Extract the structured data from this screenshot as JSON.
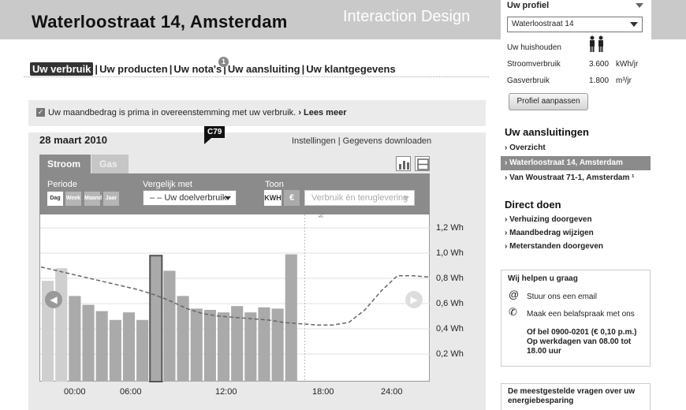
{
  "header": {
    "title": "Waterloostraat 14, Amsterdam",
    "watermark": "Interaction Design"
  },
  "nav": {
    "items": [
      "Uw verbruik",
      "Uw producten",
      "Uw nota's",
      "Uw aansluiting",
      "Uw klantgegevens"
    ],
    "separator": "|",
    "badge": "1"
  },
  "notice": {
    "text": "Uw maandbedrag is prima in overeenstemming met uw verbruik.",
    "link": "Lees meer",
    "link_prefix": "›"
  },
  "panel": {
    "date": "28 maart 2010",
    "marker": "C79",
    "links": {
      "settings": "Instellingen",
      "sep": "|",
      "download": "Gegevens downloaden"
    },
    "tabs": [
      "Stroom",
      "Gas"
    ],
    "periode_label": "Periode",
    "periode_buttons": [
      "Dag",
      "Week",
      "Maand",
      "Jaar"
    ],
    "vergelijk_label": "Vergelijk met",
    "vergelijk_value": "– – Uw doelverbruik",
    "toon_label": "Toon",
    "toon_buttons": [
      "KWH",
      "€"
    ],
    "toon_select": "Verbruik én teruglevering",
    "now_label": "Nu"
  },
  "chart_data": {
    "type": "bar",
    "unit": "Wh",
    "x_ticks": [
      "00:00",
      "06:00",
      "12:00",
      "18:00",
      "24:00"
    ],
    "y_ticks": [
      "0,2 Wh",
      "0,4 Wh",
      "0,6 Wh",
      "0,8 Wh",
      "1,0 Wh",
      "1,2 Wh"
    ],
    "ylim": [
      0.1,
      1.3
    ],
    "hours": [
      0,
      1,
      2,
      3,
      4,
      5,
      6,
      7,
      8,
      9,
      10,
      11,
      12,
      13,
      14,
      15,
      16,
      17,
      18
    ],
    "values": [
      0.78,
      0.88,
      0.66,
      0.59,
      0.54,
      0.47,
      0.53,
      0.47,
      0.98,
      0.86,
      0.66,
      0.56,
      0.55,
      0.53,
      0.58,
      0.53,
      0.57,
      0.56,
      0.99
    ],
    "target_line": [
      0.89,
      0.86,
      0.83,
      0.8,
      0.77,
      0.74,
      0.71,
      0.67,
      0.62,
      0.56,
      0.52,
      0.5,
      0.49,
      0.48,
      0.47,
      0.45,
      0.44,
      0.43,
      0.43,
      0.45,
      0.55,
      0.7,
      0.82,
      0.82,
      0.81
    ],
    "selected_hour": 8,
    "now_hour": 19.5,
    "colors": {
      "bar_past": "#cfcfcf",
      "bar_today": "#aaaaaa",
      "selected_border": "#555555",
      "target": "#666666"
    }
  },
  "profile": {
    "title": "Uw profiel",
    "address": "Waterloostraat 14",
    "rows": [
      {
        "label": "Uw huishouden",
        "value": "",
        "unit": ""
      },
      {
        "label": "Stroomverbruik",
        "value": "3.600",
        "unit": "kWh/jr"
      },
      {
        "label": "Gasverbruik",
        "value": "1.800",
        "unit": "m³/jr"
      }
    ],
    "button": "Profiel aanpassen"
  },
  "aansluitingen": {
    "title": "Uw aansluitingen",
    "items": [
      "› Overzicht",
      "› Waterloostraat 14, Amsterdam",
      "› Van Woustraat 71-1, Amsterdam ¹"
    ]
  },
  "direct": {
    "title": "Direct doen",
    "items": [
      "› Verhuizing doorgeven",
      "› Maandbedrag wijzigen",
      "› Meterstanden doorgeven"
    ]
  },
  "help": {
    "title": "Wij helpen u graag",
    "email": "Stuur ons een email",
    "call": "Maak een belafspraak met ons",
    "phone": "Of bel 0900-0201 (€ 0,10 p.m.)",
    "hours1": "Op werkdagen van 08.00 tot",
    "hours2": "18.00 uur"
  },
  "faq": {
    "text": "De meestgestelde vragen over uw energiebesparing"
  }
}
